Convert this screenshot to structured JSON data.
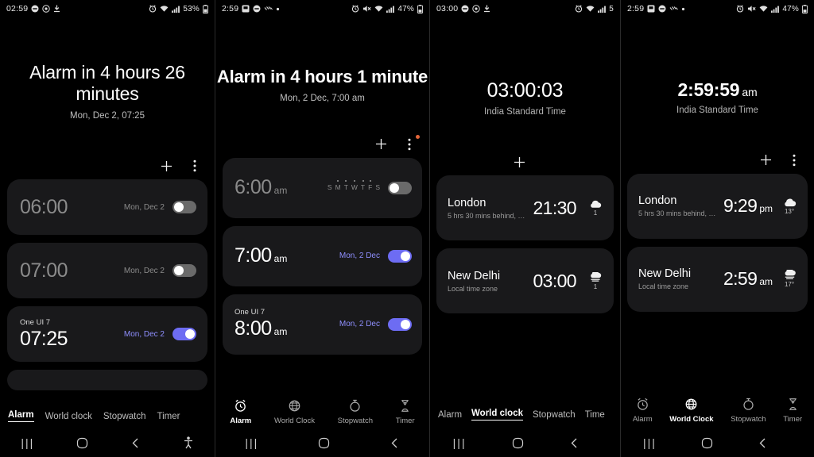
{
  "accent": "#6d6cf3",
  "card_bg": "#19191b",
  "panels": [
    {
      "id": "alarm-list-1",
      "statusbar": {
        "time": "02:59",
        "left_icons": [
          "dnd-icon",
          "circle-icon",
          "download-icon"
        ],
        "right_icons": [
          "alarm-icon",
          "wifi-icon",
          "signal-icon"
        ],
        "battery_pct": "53%"
      },
      "hero": {
        "title": "Alarm in 4 hours 26 minutes",
        "subtitle": "Mon, Dec 2, 07:25"
      },
      "actions": {
        "add": "add-icon",
        "more": "more-vertical-icon",
        "badge": false
      },
      "alarms": [
        {
          "label": "",
          "time": "06:00",
          "ampm": "",
          "days": "Mon, Dec 2",
          "enabled": false
        },
        {
          "label": "",
          "time": "07:00",
          "ampm": "",
          "days": "Mon, Dec 2",
          "enabled": false
        },
        {
          "label": "One UI 7",
          "time": "07:25",
          "ampm": "",
          "days": "Mon, Dec 2",
          "enabled": true
        }
      ],
      "tabs": {
        "style": "text",
        "items": [
          "Alarm",
          "World clock",
          "Stopwatch",
          "Timer"
        ],
        "active": 0
      },
      "navbar": [
        "recents-icon",
        "home-icon",
        "back-icon",
        "accessibility-icon"
      ]
    },
    {
      "id": "alarm-list-2",
      "statusbar": {
        "time": "2:59",
        "left_icons": [
          "screenshot-icon",
          "dnd-icon",
          "vibrate-icon",
          "dot-icon"
        ],
        "right_icons": [
          "alarm-icon",
          "mute-icon",
          "wifi-icon",
          "signal-icon"
        ],
        "battery_pct": "47%"
      },
      "hero": {
        "title": "Alarm in 4 hours 1 minute",
        "subtitle": "Mon, 2 Dec, 7:00 am"
      },
      "actions": {
        "add": "add-icon",
        "more": "more-vertical-icon",
        "badge": true
      },
      "alarms": [
        {
          "label": "",
          "time": "6:00",
          "ampm": "am",
          "daysel": [
            "S",
            "M",
            "T",
            "W",
            "T",
            "F",
            "S"
          ],
          "daysel_active": [
            1,
            2,
            3,
            4,
            5
          ],
          "enabled": false
        },
        {
          "label": "",
          "time": "7:00",
          "ampm": "am",
          "days": "Mon, 2 Dec",
          "enabled": true
        },
        {
          "label": "One UI 7",
          "time": "8:00",
          "ampm": "am",
          "days": "Mon, 2 Dec",
          "enabled": true
        }
      ],
      "tabs": {
        "style": "icon",
        "items": [
          "Alarm",
          "World Clock",
          "Stopwatch",
          "Timer"
        ],
        "active": 0
      },
      "navbar": [
        "recents-icon",
        "home-icon",
        "back-icon"
      ]
    },
    {
      "id": "world-clock-1",
      "statusbar": {
        "time": "03:00",
        "left_icons": [
          "dnd-icon",
          "circle-icon",
          "download-icon"
        ],
        "right_icons": [
          "alarm-icon",
          "wifi-icon",
          "signal-icon"
        ],
        "battery_pct": "5"
      },
      "hero": {
        "title": "03:00:03",
        "ampm": "",
        "subtitle": "India Standard Time"
      },
      "actions": {
        "add": "add-icon",
        "more": "",
        "badge": false
      },
      "cities": [
        {
          "city": "London",
          "offset": "5 hrs 30 mins behind, Yes…",
          "time": "21:30",
          "ampm": "",
          "weather": "cloud-icon",
          "temp": "1"
        },
        {
          "city": "New Delhi",
          "offset": "Local time zone",
          "time": "03:00",
          "ampm": "",
          "weather": "fog-icon",
          "temp": "1"
        }
      ],
      "tabs": {
        "style": "text",
        "items": [
          "Alarm",
          "World clock",
          "Stopwatch",
          "Time"
        ],
        "active": 1
      },
      "navbar": [
        "recents-icon",
        "home-icon",
        "back-icon"
      ]
    },
    {
      "id": "world-clock-2",
      "statusbar": {
        "time": "2:59",
        "left_icons": [
          "screenshot-icon",
          "dnd-icon",
          "vibrate-icon",
          "dot-icon"
        ],
        "right_icons": [
          "alarm-icon",
          "mute-icon",
          "wifi-icon",
          "signal-icon"
        ],
        "battery_pct": "47%"
      },
      "hero": {
        "title": "2:59:59",
        "ampm": "am",
        "subtitle": "India Standard Time"
      },
      "actions": {
        "add": "add-icon",
        "more": "more-vertical-icon",
        "badge": false
      },
      "cities": [
        {
          "city": "London",
          "offset": "5 hrs 30 mins behind, Y…",
          "time": "9:29",
          "ampm": "pm",
          "weather": "cloud-icon",
          "temp": "13°"
        },
        {
          "city": "New Delhi",
          "offset": "Local time zone",
          "time": "2:59",
          "ampm": "am",
          "weather": "fog-icon",
          "temp": "17°"
        }
      ],
      "tabs": {
        "style": "icon",
        "items": [
          "Alarm",
          "World Clock",
          "Stopwatch",
          "Timer"
        ],
        "active": 1
      },
      "navbar": [
        "recents-icon",
        "home-icon",
        "back-icon"
      ]
    }
  ]
}
